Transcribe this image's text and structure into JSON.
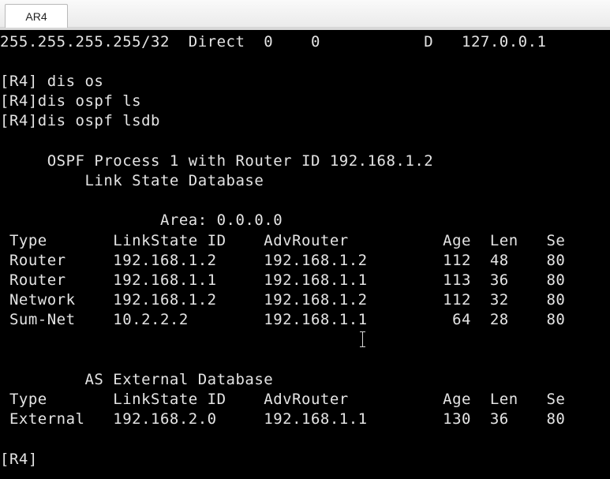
{
  "window": {
    "tab_title": "AR4"
  },
  "terminal": {
    "lines": [
      "255.255.255.255/32  Direct  0    0           D   127.0.0.1",
      "",
      "[R4] dis os",
      "[R4]dis ospf ls",
      "[R4]dis ospf lsdb",
      "",
      "     OSPF Process 1 with Router ID 192.168.1.2",
      "         Link State Database",
      "",
      "                 Area: 0.0.0.0",
      " Type       LinkState ID    AdvRouter          Age  Len   Se",
      " Router     192.168.1.2     192.168.1.2        112  48    80",
      " Router     192.168.1.1     192.168.1.1        113  36    80",
      " Network    192.168.1.2     192.168.1.2        112  32    80",
      " Sum-Net    10.2.2.2        192.168.1.1         64  28    80",
      "",
      "",
      "         AS External Database",
      " Type       LinkState ID    AdvRouter          Age  Len   Se",
      " External   192.168.2.0     192.168.1.1        130  36    80",
      "",
      "[R4]"
    ]
  }
}
